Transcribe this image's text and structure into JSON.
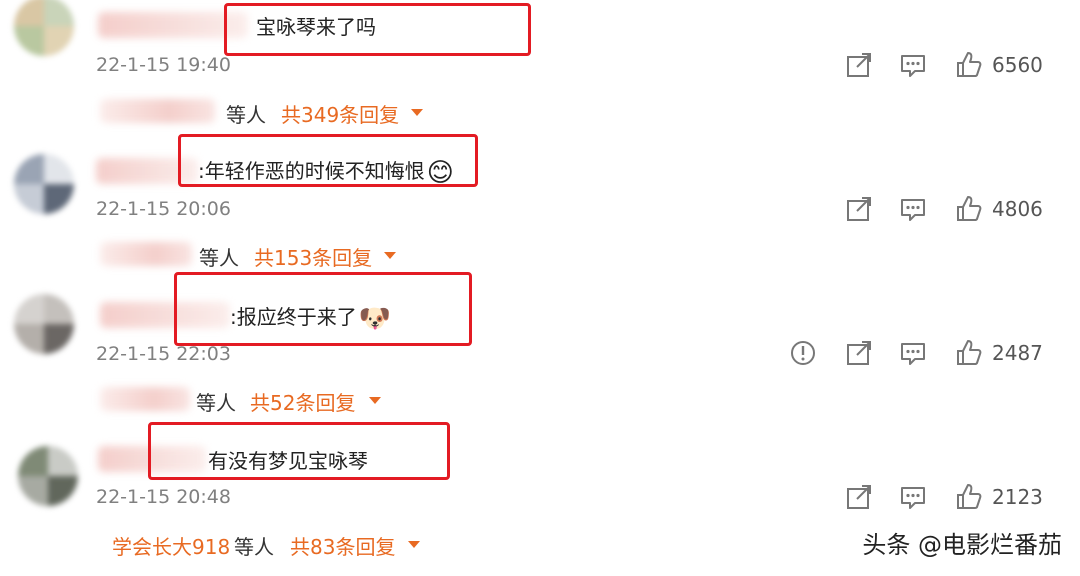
{
  "comments": [
    {
      "text": "宝咏琴来了吗",
      "name_fragment": "",
      "timestamp": "22-1-15 19:40",
      "likes": "6560",
      "reply_names_fragment": "",
      "reply_user": "",
      "reply_others": "等人",
      "reply_total": "共349条回复",
      "has_report": false,
      "emoji": ""
    },
    {
      "text": ":年轻作恶的时候不知悔恨",
      "name_fragment": "",
      "timestamp": "22-1-15 20:06",
      "likes": "4806",
      "reply_names_fragment": "",
      "reply_user": "",
      "reply_others": "等人",
      "reply_total": "共153条回复",
      "has_report": false,
      "emoji": "😊"
    },
    {
      "text": ":报应终于来了",
      "name_fragment": "",
      "timestamp": "22-1-15 22:03",
      "likes": "2487",
      "reply_names_fragment": "",
      "reply_user": "",
      "reply_others": "等人",
      "reply_total": "共52条回复",
      "has_report": true,
      "emoji": "🐶"
    },
    {
      "text": "有没有梦见宝咏琴",
      "name_fragment": "",
      "timestamp": "22-1-15 20:48",
      "likes": "2123",
      "reply_names_fragment": "",
      "reply_user": "学会长大918",
      "reply_others": "等人",
      "reply_total": "共83条回复",
      "has_report": false,
      "emoji": ""
    }
  ],
  "icons": {
    "share": "share-icon",
    "comment": "comment-icon",
    "like": "thumbs-up-icon",
    "report": "report-icon",
    "dropdown": "caret-down-icon"
  },
  "colors": {
    "accent": "#e86a22",
    "highlight_box": "#e31b23",
    "timestamp": "#808080"
  },
  "watermark": "头条 @电影烂番茄"
}
